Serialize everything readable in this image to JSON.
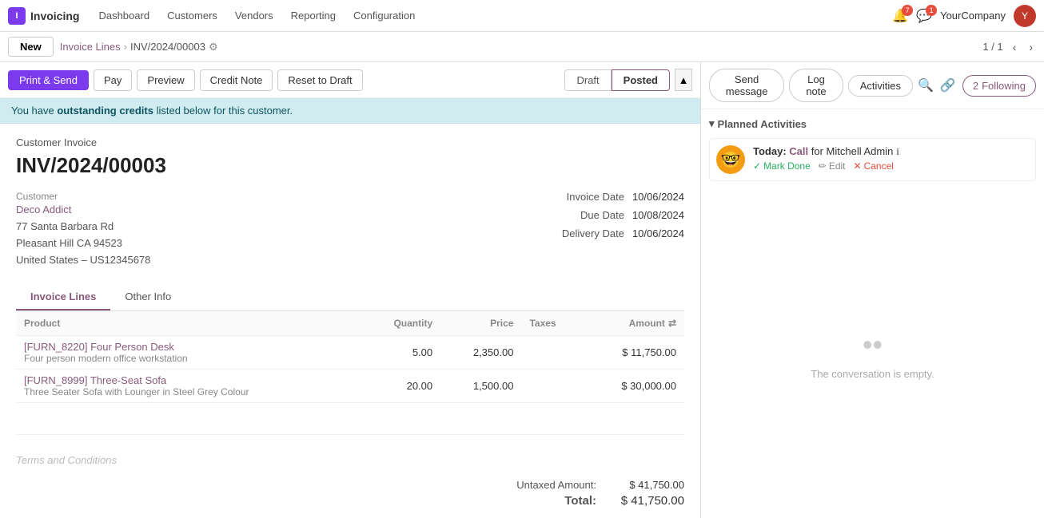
{
  "topnav": {
    "logo_text": "I",
    "app_name": "Invoicing",
    "nav_items": [
      "Dashboard",
      "Customers",
      "Vendors",
      "Reporting",
      "Configuration"
    ],
    "notif1_count": "7",
    "notif2_count": "1",
    "company_name": "YourCompany",
    "avatar_text": "Y"
  },
  "subnav": {
    "new_label": "New",
    "breadcrumb_link": "Invoice Lines",
    "breadcrumb_current": "INV/2024/00003",
    "pagination": "1 / 1"
  },
  "action_bar": {
    "print_send": "Print & Send",
    "pay": "Pay",
    "preview": "Preview",
    "credit_note": "Credit Note",
    "reset_to_draft": "Reset to Draft",
    "status_draft": "Draft",
    "status_posted": "Posted"
  },
  "alert": {
    "text_before": "You have ",
    "highlight": "outstanding credits",
    "text_after": " listed below for this customer."
  },
  "form": {
    "invoice_type": "Customer Invoice",
    "invoice_number": "INV/2024/00003",
    "customer_label": "Customer",
    "customer_name": "Deco Addict",
    "customer_address_line1": "77 Santa Barbara Rd",
    "customer_address_line2": "Pleasant Hill CA 94523",
    "customer_address_line3": "United States – US12345678",
    "invoice_date_label": "Invoice Date",
    "invoice_date_value": "10/06/2024",
    "due_date_label": "Due Date",
    "due_date_value": "10/08/2024",
    "delivery_date_label": "Delivery Date",
    "delivery_date_value": "10/06/2024"
  },
  "tabs": [
    {
      "id": "invoice-lines",
      "label": "Invoice Lines",
      "active": true
    },
    {
      "id": "other-info",
      "label": "Other Info",
      "active": false
    }
  ],
  "table": {
    "headers": [
      "Product",
      "Quantity",
      "Price",
      "Taxes",
      "Amount"
    ],
    "rows": [
      {
        "product_link": "[FURN_8220] Four Person Desk",
        "product_desc": "Four person modern office workstation",
        "quantity": "5.00",
        "price": "2,350.00",
        "taxes": "",
        "amount": "$ 11,750.00"
      },
      {
        "product_link": "[FURN_8999] Three-Seat Sofa",
        "product_desc": "Three Seater Sofa with Lounger in Steel Grey Colour",
        "quantity": "20.00",
        "price": "1,500.00",
        "taxes": "",
        "amount": "$ 30,000.00"
      }
    ]
  },
  "totals": {
    "terms_placeholder": "Terms and Conditions",
    "untaxed_label": "Untaxed Amount:",
    "untaxed_value": "$ 41,750.00",
    "total_label": "Total:",
    "total_value": "$ 41,750.00"
  },
  "chatter": {
    "send_message": "Send message",
    "log_note": "Log note",
    "activities": "Activities",
    "followers_label": "Following",
    "followers_count": "2"
  },
  "planned_activities": {
    "header": "Planned Activities",
    "activity": {
      "today_label": "Today:",
      "call_label": "Call",
      "for_text": "for Mitchell Admin",
      "mark_done": "Mark Done",
      "edit": "Edit",
      "cancel": "Cancel"
    }
  },
  "conversation": {
    "empty_text": "The conversation is empty."
  }
}
